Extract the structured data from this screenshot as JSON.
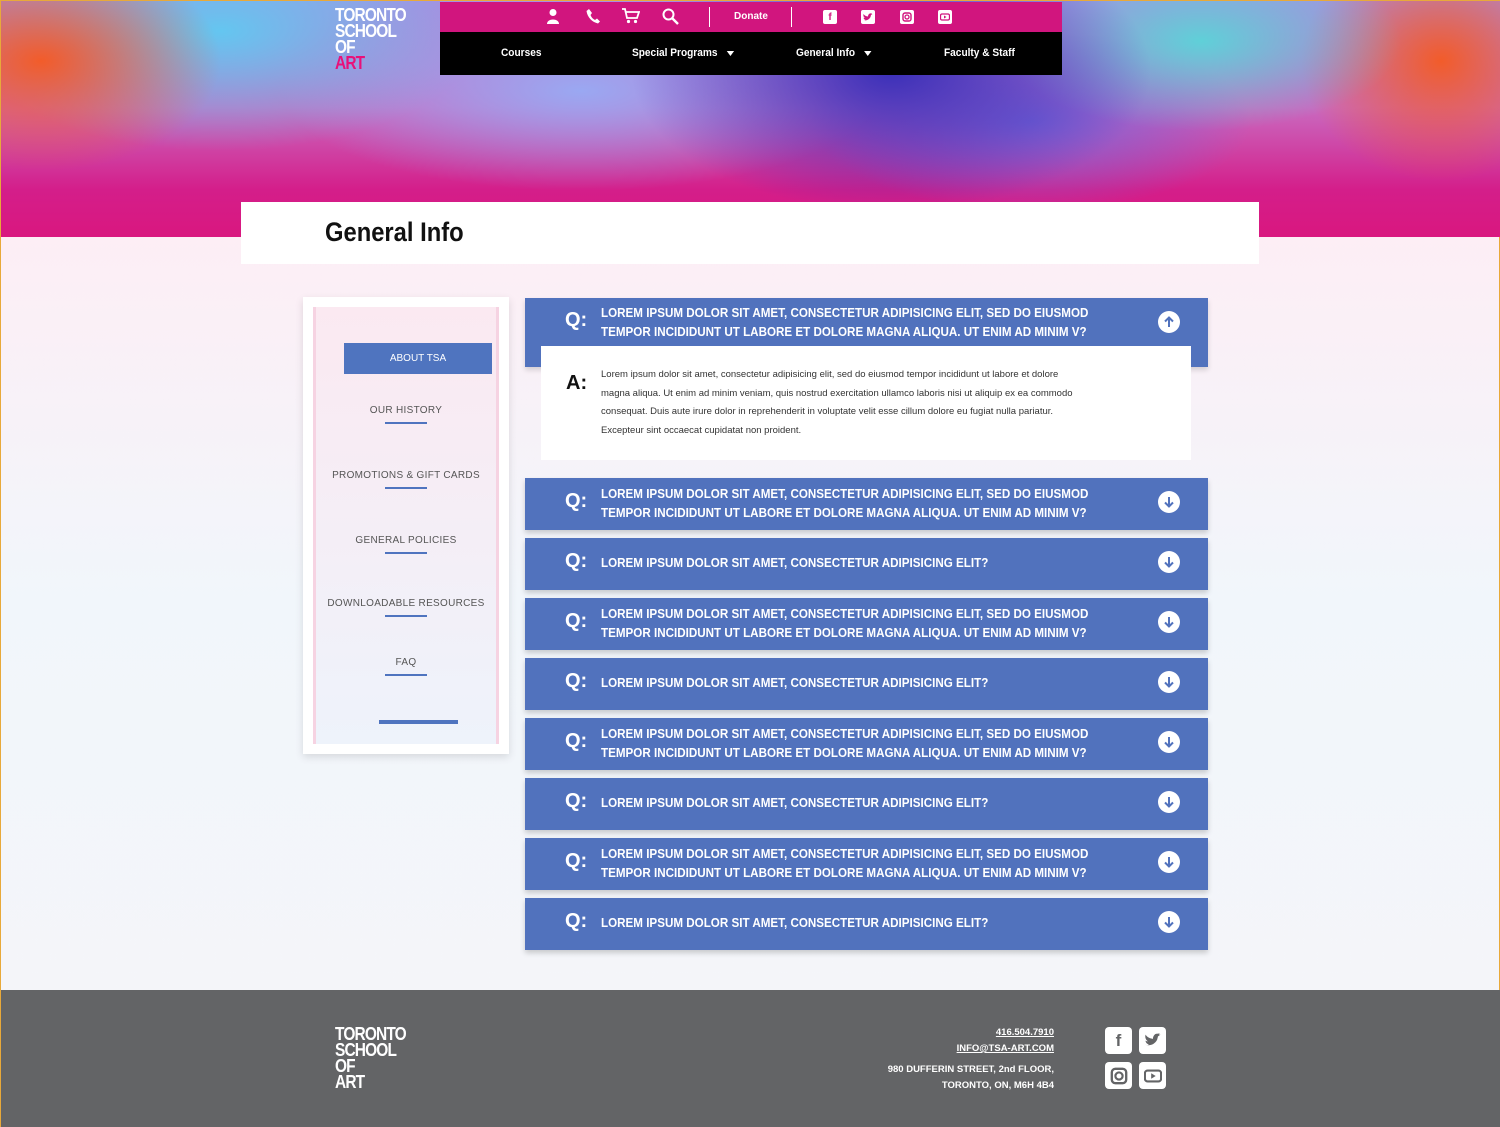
{
  "brand": {
    "logo_lines": [
      "TORONTO",
      "SCHOOL",
      "OF",
      "ART"
    ]
  },
  "topbar": {
    "icons": [
      "user-icon",
      "phone-icon",
      "cart-icon",
      "search-icon"
    ],
    "donate_label": "Donate",
    "social": [
      "facebook-icon",
      "twitter-icon",
      "instagram-icon",
      "youtube-icon"
    ],
    "colors": {
      "bar": "#d1157e",
      "nav": "#000000"
    }
  },
  "nav": {
    "items": [
      {
        "label": "Courses",
        "has_dropdown": false
      },
      {
        "label": "Special Programs",
        "has_dropdown": true
      },
      {
        "label": "General Info",
        "has_dropdown": true
      },
      {
        "label": "Faculty & Staff",
        "has_dropdown": false
      }
    ]
  },
  "page": {
    "title": "General Info"
  },
  "sidebar": {
    "active": "ABOUT TSA",
    "items": [
      "OUR HISTORY",
      "PROMOTIONS & GIFT CARDS",
      "GENERAL POLICIES",
      "DOWNLOADABLE RESOURCES",
      "FAQ"
    ]
  },
  "faq": {
    "q_prefix": "Q:",
    "a_prefix": "A:",
    "open": {
      "question_lines": [
        "LOREM IPSUM DOLOR SIT AMET, CONSECTETUR ADIPISICING ELIT, SED DO EIUSMOD",
        "TEMPOR INCIDIDUNT UT LABORE ET DOLORE MAGNA ALIQUA. UT ENIM AD MINIM V?"
      ],
      "answer_lines": [
        "Lorem ipsum dolor sit amet, consectetur adipisicing elit, sed do eiusmod tempor incididunt ut labore et dolore",
        "magna aliqua. Ut enim ad minim veniam, quis nostrud exercitation ullamco laboris nisi ut aliquip ex ea commodo",
        "consequat. Duis aute irure dolor in reprehenderit in voluptate velit esse cillum dolore eu fugiat nulla pariatur.",
        "Excepteur sint occaecat cupidatat non proident."
      ]
    },
    "items": [
      {
        "lines": [
          "LOREM IPSUM DOLOR SIT AMET, CONSECTETUR ADIPISICING ELIT, SED DO EIUSMOD",
          "TEMPOR INCIDIDUNT UT LABORE ET DOLORE MAGNA ALIQUA. UT ENIM AD MINIM V?"
        ]
      },
      {
        "lines": [
          "LOREM IPSUM DOLOR SIT AMET, CONSECTETUR ADIPISICING ELIT?"
        ]
      },
      {
        "lines": [
          "LOREM IPSUM DOLOR SIT AMET, CONSECTETUR ADIPISICING ELIT, SED DO EIUSMOD",
          "TEMPOR INCIDIDUNT UT LABORE ET DOLORE MAGNA ALIQUA. UT ENIM AD MINIM V?"
        ]
      },
      {
        "lines": [
          "LOREM IPSUM DOLOR SIT AMET, CONSECTETUR ADIPISICING ELIT?"
        ]
      },
      {
        "lines": [
          "LOREM IPSUM DOLOR SIT AMET, CONSECTETUR ADIPISICING ELIT, SED DO EIUSMOD",
          "TEMPOR INCIDIDUNT UT LABORE ET DOLORE MAGNA ALIQUA. UT ENIM AD MINIM V?"
        ]
      },
      {
        "lines": [
          "LOREM IPSUM DOLOR SIT AMET, CONSECTETUR ADIPISICING ELIT?"
        ]
      },
      {
        "lines": [
          "LOREM IPSUM DOLOR SIT AMET, CONSECTETUR ADIPISICING ELIT, SED DO EIUSMOD",
          "TEMPOR INCIDIDUNT UT LABORE ET DOLORE MAGNA ALIQUA. UT ENIM AD MINIM V?"
        ]
      },
      {
        "lines": [
          "LOREM IPSUM DOLOR SIT AMET, CONSECTETUR ADIPISICING ELIT?"
        ]
      }
    ],
    "colors": {
      "question_bg": "#5172bd"
    }
  },
  "footer": {
    "phone": "416.504.7910",
    "email": "INFO@TSA-ART.COM",
    "address_line1": "980 DUFFERIN STREET, 2nd FLOOR,",
    "address_line2": "TORONTO, ON, M6H 4B4",
    "social": [
      "facebook-icon",
      "twitter-icon",
      "instagram-icon",
      "youtube-icon"
    ]
  }
}
